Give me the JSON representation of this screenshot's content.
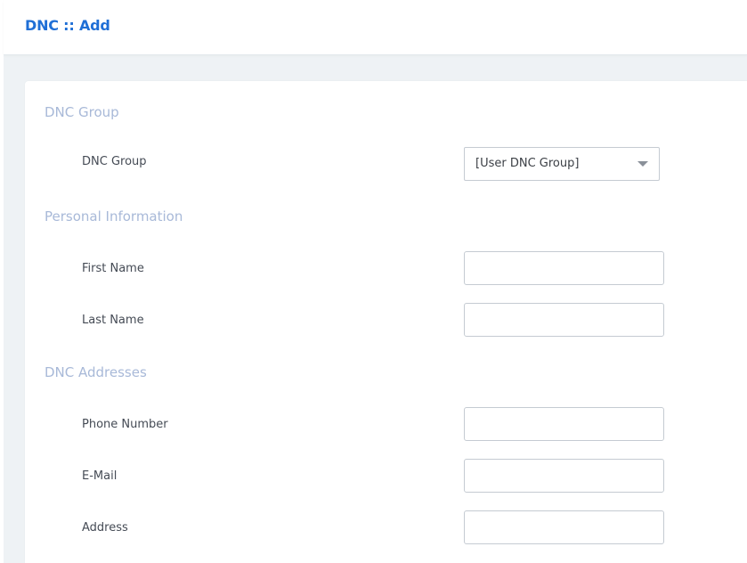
{
  "header": {
    "title": "DNC :: Add"
  },
  "sections": {
    "dnc_group": {
      "heading": "DNC Group",
      "group_label": "DNC Group",
      "group_selected": "[User DNC Group]"
    },
    "personal_information": {
      "heading": "Personal Information",
      "first_name_label": "First Name",
      "first_name_value": "",
      "last_name_label": "Last Name",
      "last_name_value": ""
    },
    "dnc_addresses": {
      "heading": "DNC Addresses",
      "phone_label": "Phone Number",
      "phone_value": "",
      "email_label": "E-Mail",
      "email_value": "",
      "address_label": "Address",
      "address_value": ""
    }
  },
  "colors": {
    "title": "#1f6fd6",
    "section_heading": "#a8b9d8",
    "label": "#454b55",
    "background": "#eef2f5"
  }
}
